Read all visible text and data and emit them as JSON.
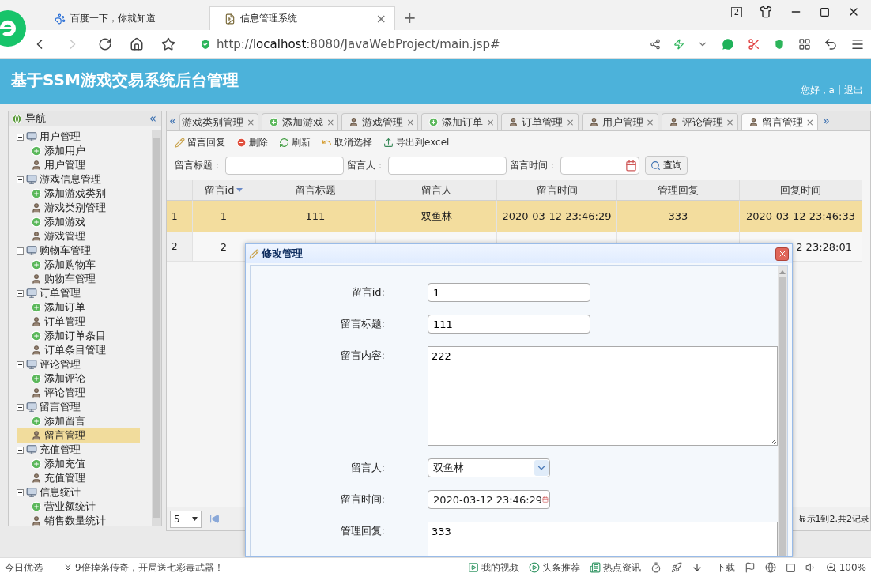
{
  "browser": {
    "tabs": [
      {
        "label": "百度一下，你就知道",
        "kind": "paw",
        "selected": false
      },
      {
        "label": "信息管理系统",
        "kind": "page",
        "selected": true,
        "close": "×"
      }
    ],
    "new_tab": "+",
    "tab_count": "2",
    "address": "http://**localhost**:8080/JavaWebProject/main.jsp#"
  },
  "header": {
    "title": "基于SSM游戏交易系统后台管理",
    "greeting": "您好，a",
    "separator": "|",
    "logout": "退出"
  },
  "sidebar": {
    "title": "导航",
    "collapse": "«",
    "tree": [
      {
        "label": "用户管理",
        "expanded": true,
        "children": [
          {
            "label": "添加用户",
            "kind": "add",
            "selected": false
          },
          {
            "label": "用户管理",
            "kind": "manage",
            "selected": false
          }
        ]
      },
      {
        "label": "游戏信息管理",
        "expanded": true,
        "children": [
          {
            "label": "添加游戏类别",
            "kind": "add",
            "selected": false
          },
          {
            "label": "游戏类别管理",
            "kind": "manage",
            "selected": false
          },
          {
            "label": "添加游戏",
            "kind": "add",
            "selected": false
          },
          {
            "label": "游戏管理",
            "kind": "manage",
            "selected": false
          }
        ]
      },
      {
        "label": "购物车管理",
        "expanded": true,
        "children": [
          {
            "label": "添加购物车",
            "kind": "add",
            "selected": false
          },
          {
            "label": "购物车管理",
            "kind": "manage",
            "selected": false
          }
        ]
      },
      {
        "label": "订单管理",
        "expanded": true,
        "children": [
          {
            "label": "添加订单",
            "kind": "add",
            "selected": false
          },
          {
            "label": "订单管理",
            "kind": "manage",
            "selected": false
          },
          {
            "label": "添加订单条目",
            "kind": "add",
            "selected": false
          },
          {
            "label": "订单条目管理",
            "kind": "manage",
            "selected": false
          }
        ]
      },
      {
        "label": "评论管理",
        "expanded": true,
        "children": [
          {
            "label": "添加评论",
            "kind": "add",
            "selected": false
          },
          {
            "label": "评论管理",
            "kind": "manage",
            "selected": false
          }
        ]
      },
      {
        "label": "留言管理",
        "expanded": true,
        "children": [
          {
            "label": "添加留言",
            "kind": "add",
            "selected": false
          },
          {
            "label": "留言管理",
            "kind": "manage",
            "selected": true
          }
        ]
      },
      {
        "label": "充值管理",
        "expanded": true,
        "children": [
          {
            "label": "添加充值",
            "kind": "add",
            "selected": false
          },
          {
            "label": "充值管理",
            "kind": "manage",
            "selected": false
          }
        ]
      },
      {
        "label": "信息统计",
        "expanded": true,
        "children": [
          {
            "label": "营业额统计",
            "kind": "add",
            "selected": false
          },
          {
            "label": "销售数量统计",
            "kind": "manage",
            "selected": false
          }
        ]
      }
    ]
  },
  "tabs": {
    "scroll_left": "«",
    "scroll_right": "»",
    "items": [
      {
        "label": "游戏类别管理",
        "kind": "cut",
        "selected": false,
        "close": "×"
      },
      {
        "label": "添加游戏",
        "kind": "add",
        "selected": false,
        "close": "×"
      },
      {
        "label": "游戏管理",
        "kind": "manage",
        "selected": false,
        "close": "×"
      },
      {
        "label": "添加订单",
        "kind": "add",
        "selected": false,
        "close": "×"
      },
      {
        "label": "订单管理",
        "kind": "manage",
        "selected": false,
        "close": "×"
      },
      {
        "label": "用户管理",
        "kind": "manage",
        "selected": false,
        "close": "×"
      },
      {
        "label": "评论管理",
        "kind": "manage",
        "selected": false,
        "close": "×"
      },
      {
        "label": "留言管理",
        "kind": "manage",
        "selected": true,
        "close": "×"
      }
    ]
  },
  "toolbar": [
    {
      "label": "留言回复",
      "kind": "edit"
    },
    {
      "label": "删除",
      "kind": "delete"
    },
    {
      "label": "刷新",
      "kind": "refresh"
    },
    {
      "label": "取消选择",
      "kind": "undo"
    },
    {
      "label": "导出到excel",
      "kind": "export"
    }
  ],
  "search": {
    "fields": [
      {
        "label": "留言标题：",
        "kind": "text"
      },
      {
        "label": "留言人：",
        "kind": "text"
      },
      {
        "label": "留言时间：",
        "kind": "date"
      }
    ],
    "button": "查询"
  },
  "table": {
    "columns": [
      {
        "label": "留言id",
        "sorted": true
      },
      {
        "label": "留言标题",
        "sorted": false
      },
      {
        "label": "留言人",
        "sorted": false
      },
      {
        "label": "留言时间",
        "sorted": false
      },
      {
        "label": "管理回复",
        "sorted": false
      },
      {
        "label": "回复时间",
        "sorted": false
      }
    ],
    "rows": [
      {
        "number": "1",
        "selected": true,
        "partly_covered": false,
        "cells": [
          "1",
          "111",
          "双鱼林",
          "2020-03-12 23:46:29",
          "333",
          "2020-03-12 23:46:33"
        ]
      },
      {
        "number": "2",
        "selected": false,
        "partly_covered": true,
        "cells": [
          "2",
          null,
          null,
          null,
          null,
          "2 23:28:01"
        ]
      }
    ]
  },
  "pagination": {
    "page_size": "5",
    "summary": "显示1到2,共2记录"
  },
  "dialog": {
    "title": "修改管理",
    "fields": [
      {
        "label": "留言id:",
        "kind": "input",
        "value": "1"
      },
      {
        "label": "留言标题:",
        "kind": "input",
        "value": "111"
      },
      {
        "label": "留言内容:",
        "kind": "textarea",
        "value": "222"
      },
      {
        "label": "留言人:",
        "kind": "select",
        "value": "双鱼林"
      },
      {
        "label": "留言时间:",
        "kind": "date",
        "value": "2020-03-12 23:46:29"
      },
      {
        "label": "管理回复:",
        "kind": "reply",
        "value": "333"
      }
    ]
  },
  "status_bar": {
    "left": "今日优选",
    "news": "9倍掉落传奇，开局送七彩毒武器！",
    "items": [
      {
        "label": "我的视频",
        "kind": "video"
      },
      {
        "label": "头条推荐",
        "kind": "play"
      },
      {
        "label": "热点资讯",
        "kind": "news"
      }
    ],
    "download": "下载",
    "zoom": "100%"
  }
}
